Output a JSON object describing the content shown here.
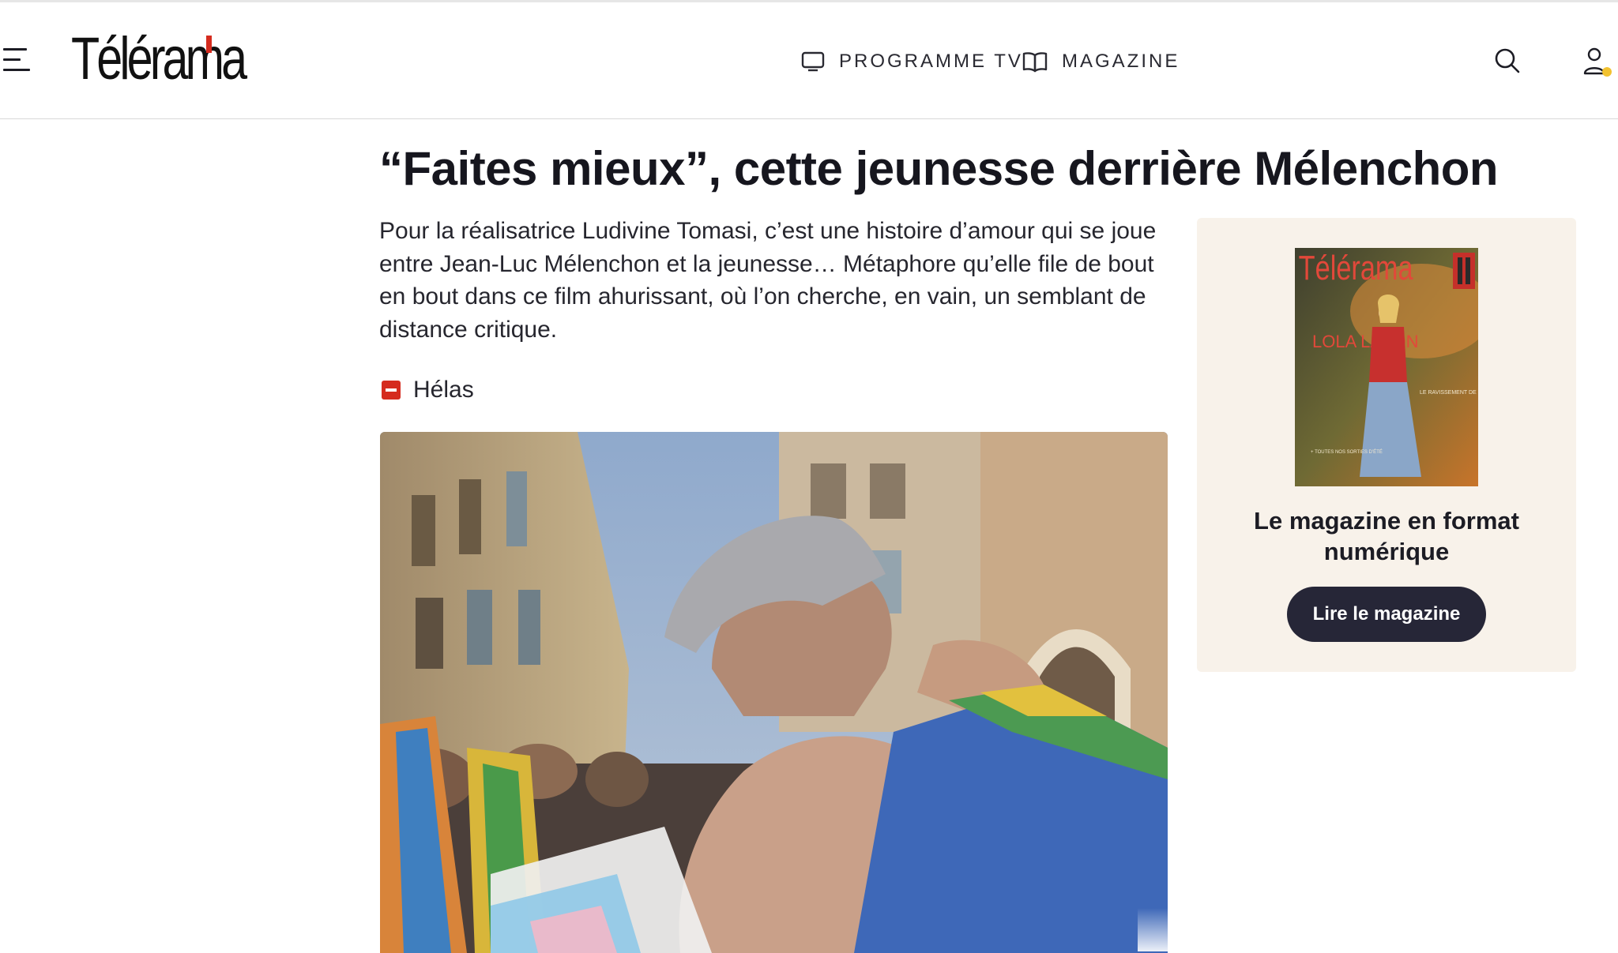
{
  "header": {
    "logo_text": "Télérama",
    "nav": [
      {
        "label": "PROGRAMME TV",
        "icon": "tv-icon"
      },
      {
        "label": "MAGAZINE",
        "icon": "book-icon"
      }
    ],
    "icons": [
      "menu-icon",
      "search-icon",
      "user-icon"
    ],
    "notification_dot_color": "#f2c230"
  },
  "article": {
    "title": "“Faites mieux”, cette jeunesse derrière Mélenchon",
    "lede": "Pour la réalisatrice Ludivine Tomasi, c’est une histoire d’amour qui se joue entre Jean-Luc Mélenchon et la jeunesse… Métaphore qu’elle file de bout en bout dans ce film ahurissant, où l’on cherche, en vain, un semblant de distance critique.",
    "rating": {
      "label": "Hélas",
      "icon": "minus-square-icon",
      "color": "#d52b1e"
    },
    "hero_image": "crowd-pride-embrace-photo"
  },
  "promo": {
    "cover": {
      "masthead": "Télérama",
      "headline": "LOLA LAFON",
      "subline": "LE RAVISSEMENT DE L’ÉCRITURE",
      "corner": "+ TOUTES NOS SORTIES D’ÉTÉ"
    },
    "title": "Le magazine en format numérique",
    "button_label": "Lire le magazine",
    "button_color": "#262637",
    "background": "#f8f2ea"
  },
  "colors": {
    "brand_red": "#d52b1e",
    "text": "#16161e"
  }
}
